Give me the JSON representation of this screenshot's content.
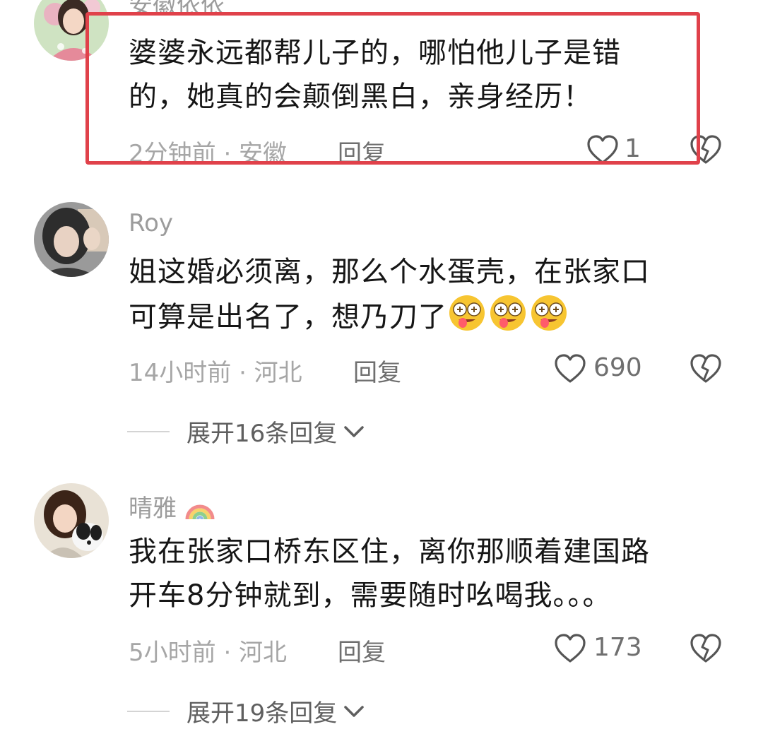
{
  "comments": [
    {
      "username": "安徽依依",
      "text": [
        "婆婆永远都帮儿子的，哪怕他儿子是错",
        "的，她真的会颠倒黑白，亲身经历！"
      ],
      "meta": "2分钟前 · 安徽",
      "reply_label": "回复",
      "likes": "1"
    },
    {
      "username": "Roy",
      "text": [
        "姐这婚必须离，那么个水蛋壳，在张家口",
        "可算是出名了，想乃刀了"
      ],
      "meta": "14小时前 · 河北",
      "reply_label": "回复",
      "likes": "690",
      "expand_label": "展开16条回复"
    },
    {
      "username": "晴雅",
      "text": [
        "我在张家口桥东区住，离你那顺着建国路",
        "开车8分钟就到，需要随时吆喝我。。。"
      ],
      "meta": "5小时前 · 河北",
      "reply_label": "回复",
      "likes": "173",
      "expand_label": "展开19条回复"
    }
  ],
  "colors": {
    "highlight_border": "#e0414a",
    "meta_text": "#a6a6a6",
    "username": "#9c9c9c"
  },
  "icons": {
    "like": "heart-outline-icon",
    "dislike": "broken-heart-icon",
    "expand": "chevron-down-icon",
    "emoji": "drooling-face-emoji",
    "username_badge": "rainbow-icon"
  }
}
